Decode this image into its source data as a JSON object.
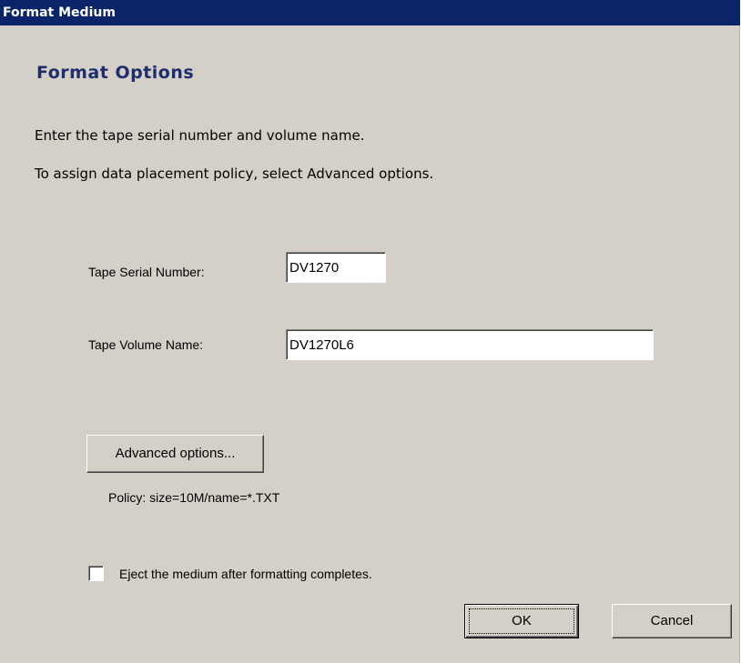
{
  "window": {
    "title": "Format Medium"
  },
  "page": {
    "heading": "Format Options",
    "instruction_1": "Enter the tape serial number and volume name.",
    "instruction_2": "To assign data placement policy, select Advanced options."
  },
  "form": {
    "serial_label": "Tape Serial Number:",
    "serial_value": "DV1270",
    "volume_label": "Tape Volume Name:",
    "volume_value": "DV1270L6"
  },
  "advanced": {
    "button_label": "Advanced options...",
    "policy_text": "Policy:   size=10M/name=*.TXT"
  },
  "eject": {
    "label": "Eject the medium after formatting completes.",
    "checked": false
  },
  "buttons": {
    "ok_label": "OK",
    "cancel_label": "Cancel"
  },
  "colors": {
    "titlebar": "#0a246a",
    "heading": "#1e2d6b",
    "dialog_bg": "#d4d0c8"
  }
}
